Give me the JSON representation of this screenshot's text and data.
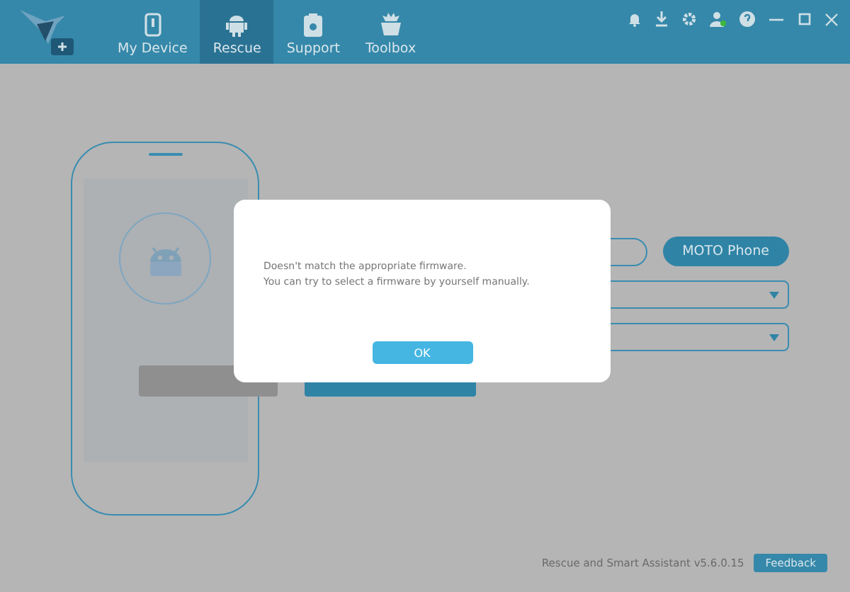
{
  "nav_tabs": [
    {
      "label": "My Device",
      "selected": false
    },
    {
      "label": "Rescue",
      "selected": true
    },
    {
      "label": "Support",
      "selected": false
    },
    {
      "label": "Toolbox",
      "selected": false
    }
  ],
  "device_type_button": "MOTO Phone",
  "action_buttons": [
    {
      "disabled": true
    },
    {
      "disabled": false
    }
  ],
  "dialog": {
    "lines": [
      "Doesn't match the appropriate firmware.",
      "You can try to select a firmware by yourself manually."
    ],
    "ok_button": "OK"
  },
  "footer": {
    "version": "Rescue and Smart Assistant v5.6.0.15",
    "feedback_button": "Feedback"
  }
}
